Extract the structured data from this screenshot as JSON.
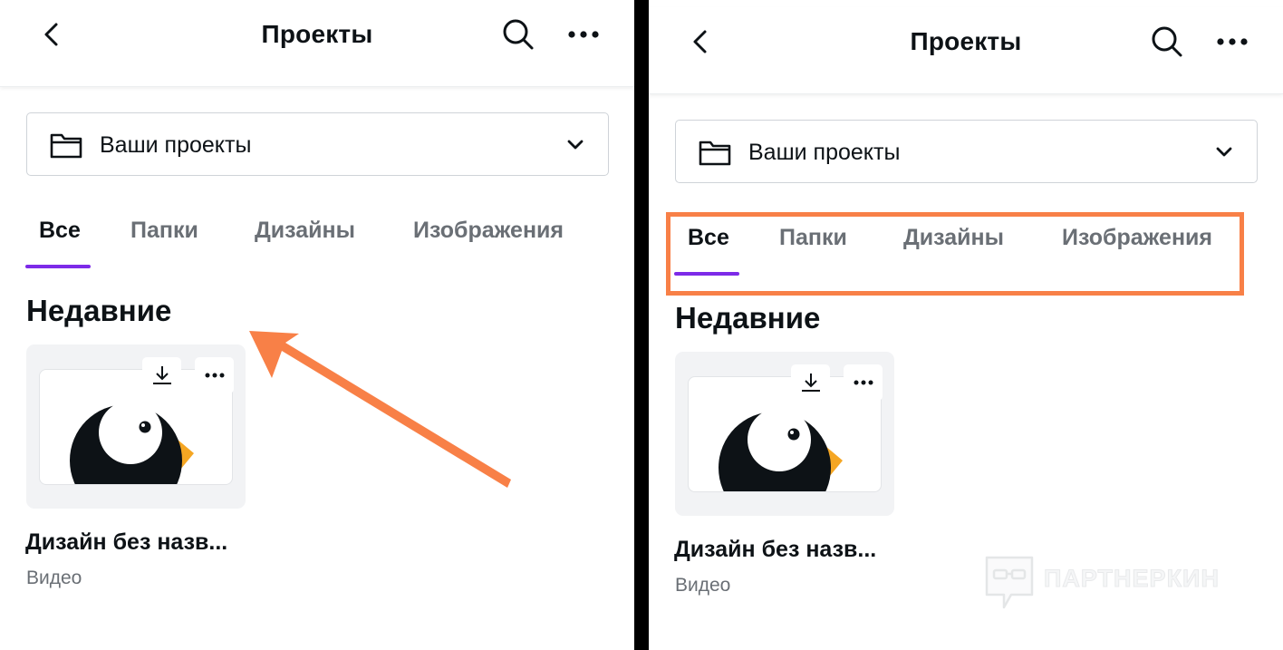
{
  "panels": [
    {
      "header": {
        "title": "Проекты"
      },
      "folder_select": {
        "label": "Ваши проекты"
      },
      "tabs": [
        {
          "label": "Все",
          "active": true
        },
        {
          "label": "Папки"
        },
        {
          "label": "Дизайны"
        },
        {
          "label": "Изображения"
        }
      ],
      "section": {
        "heading": "Недавние"
      },
      "card": {
        "title": "Дизайн без назв...",
        "type": "Видео"
      },
      "annotation": "orange-arrow"
    },
    {
      "header": {
        "title": "Проекты"
      },
      "folder_select": {
        "label": "Ваши проекты"
      },
      "tabs": [
        {
          "label": "Все",
          "active": true
        },
        {
          "label": "Папки"
        },
        {
          "label": "Дизайны"
        },
        {
          "label": "Изображения"
        }
      ],
      "section": {
        "heading": "Недавние"
      },
      "card": {
        "title": "Дизайн без назв...",
        "type": "Видео"
      },
      "annotation": "orange-highlight-box"
    }
  ],
  "watermark": {
    "text": "ПАРТНЕРКИН"
  },
  "colors": {
    "accent": "#7d2ae8",
    "annotation": "#f88047",
    "text": "#0d1216",
    "muted": "#6a6f75"
  }
}
